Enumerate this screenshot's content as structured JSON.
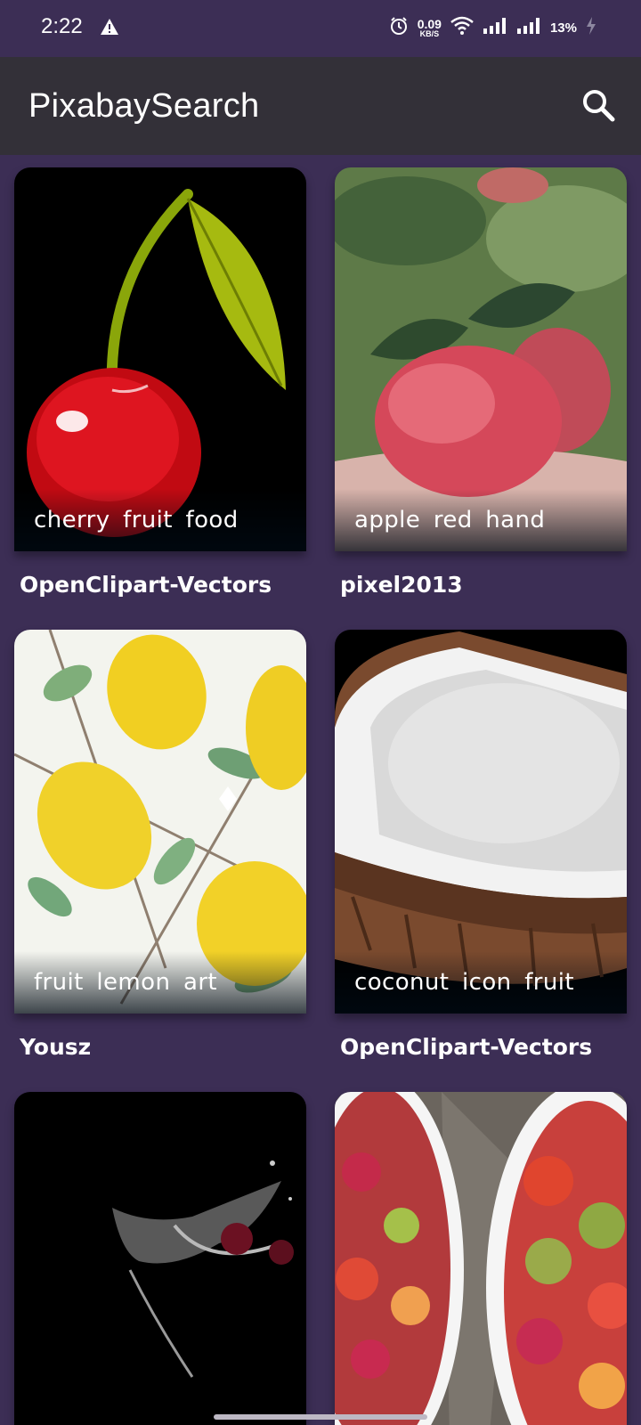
{
  "status_bar": {
    "time": "2:22",
    "net_speed_value": "0.09",
    "net_speed_unit": "KB/S",
    "battery": "13%",
    "icons": [
      "warning-icon",
      "alarm-icon",
      "wifi-icon",
      "signal-icon",
      "signal-icon",
      "charging-icon"
    ]
  },
  "app_bar": {
    "title": "PixabaySearch",
    "search_icon": "search-icon"
  },
  "results": [
    {
      "tags": "cherry  fruit  food",
      "author": "OpenClipart-Vectors"
    },
    {
      "tags": "apple  red  hand",
      "author": "pixel2013"
    },
    {
      "tags": "fruit  lemon  art",
      "author": "Yousz"
    },
    {
      "tags": "coconut  icon  fruit",
      "author": "OpenClipart-Vectors"
    },
    {
      "tags": "",
      "author": ""
    },
    {
      "tags": "",
      "author": ""
    }
  ],
  "colors": {
    "background": "#3c2e55",
    "app_bar": "#333038"
  }
}
